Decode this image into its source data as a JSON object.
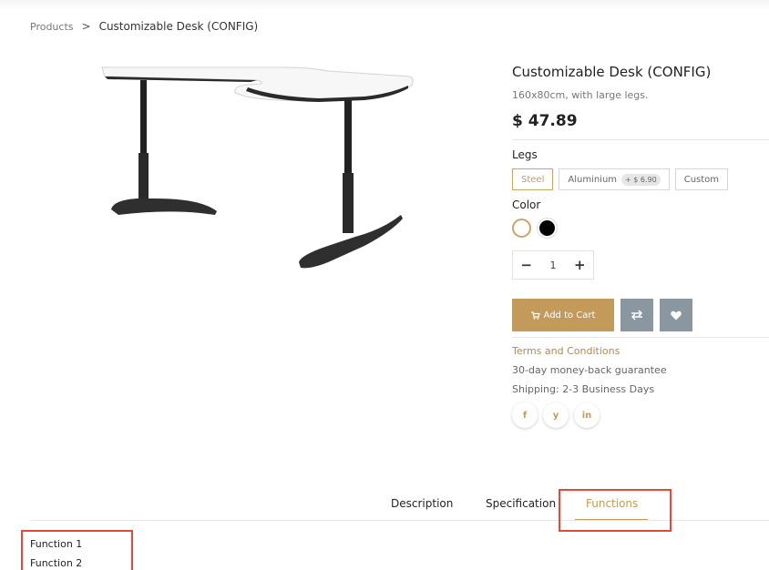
{
  "breadcrumb": {
    "root": "Products",
    "separator": ">",
    "current": "Customizable Desk (CONFIG)"
  },
  "product": {
    "title": "Customizable Desk (CONFIG)",
    "subtitle": "160x80cm, with large legs.",
    "price": "$ 47.89"
  },
  "attributes": {
    "legs_label": "Legs",
    "legs_options": [
      {
        "label": "Steel",
        "selected": true
      },
      {
        "label": "Aluminium",
        "extra": "+ $ 6.90"
      },
      {
        "label": "Custom"
      }
    ],
    "color_label": "Color",
    "colors": [
      "#ffffff",
      "#000000"
    ]
  },
  "quantity": {
    "minus": "−",
    "value": "1",
    "plus": "+"
  },
  "actions": {
    "add_to_cart": "Add to Cart",
    "compare_icon": "compare-icon",
    "wishlist_icon": "heart-icon"
  },
  "info": {
    "terms": "Terms and Conditions",
    "guarantee": "30-day money-back guarantee",
    "shipping": "Shipping: 2-3 Business Days"
  },
  "social": {
    "facebook": "f",
    "twitter": "y",
    "linkedin": "in"
  },
  "tabs": [
    {
      "label": "Description"
    },
    {
      "label": "Specification"
    },
    {
      "label": "Functions",
      "active": true
    }
  ],
  "functions": [
    "Function 1",
    "Function 2"
  ],
  "colors": {
    "accent": "#c39a59",
    "highlight": "#e24b3b",
    "icon_button": "#8b97a0"
  }
}
